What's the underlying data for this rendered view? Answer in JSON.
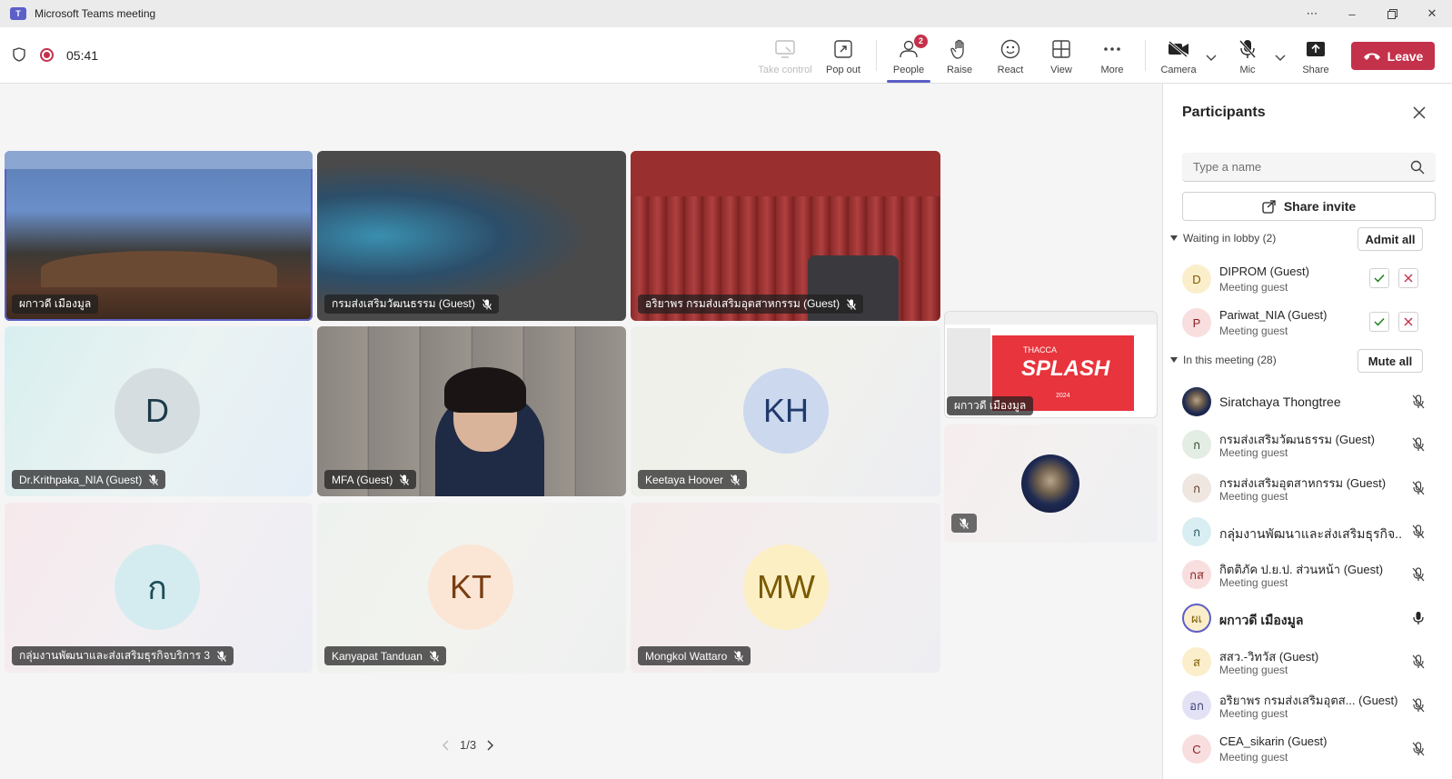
{
  "window": {
    "title": "Microsoft Teams meeting",
    "logo": "T",
    "controls": [
      "more",
      "minimize",
      "maximize",
      "close"
    ]
  },
  "toolbar": {
    "timer": "05:41",
    "take_control": "Take control",
    "pop_out": "Pop out",
    "people": "People",
    "people_badge": "2",
    "raise": "Raise",
    "react": "React",
    "view": "View",
    "more": "More",
    "camera": "Camera",
    "mic": "Mic",
    "share": "Share",
    "leave": "Leave",
    "colors": {
      "accent": "#5b5fc7",
      "leave": "#c4314b"
    }
  },
  "stage": {
    "tiles": [
      {
        "name": "ผกาวดี เมืองมูล",
        "kind": "video"
      },
      {
        "name": "กรมส่งเสริมวัฒนธรรม (Guest)",
        "kind": "video"
      },
      {
        "name": "อริยาพร กรมส่งเสริมอุตสาหกรรม (Guest)",
        "kind": "video"
      },
      {
        "name": "Dr.Krithpaka_NIA (Guest)",
        "initials": "D",
        "kind": "avatar"
      },
      {
        "name": "MFA (Guest)",
        "kind": "video"
      },
      {
        "name": "Keetaya Hoover",
        "initials": "KH",
        "kind": "avatar"
      },
      {
        "name": "กลุ่มงานพัฒนาและส่งเสริมธุรกิจบริการ 3",
        "initials": "ก",
        "kind": "avatar"
      },
      {
        "name": "Kanyapat Tanduan",
        "initials": "KT",
        "kind": "avatar"
      },
      {
        "name": "Mongkol Wattaro",
        "initials": "MW",
        "kind": "avatar"
      }
    ],
    "side_share": {
      "name": "ผกาวดี เมืองมูล",
      "slide_title": "THACCA",
      "slide_word": "SPLASH",
      "slide_year": "2024"
    },
    "pager": "1/3"
  },
  "panel": {
    "title": "Participants",
    "search_placeholder": "Type a name",
    "share_invite": "Share invite",
    "lobby_header": "Waiting in lobby (2)",
    "admit_all": "Admit all",
    "lobby": [
      {
        "initials": "D",
        "name": "DIPROM (Guest)",
        "sub": "Meeting guest"
      },
      {
        "initials": "P",
        "name": "Pariwat_NIA (Guest)",
        "sub": "Meeting guest"
      }
    ],
    "meeting_header": "In this meeting (28)",
    "mute_all": "Mute all",
    "members": [
      {
        "initials": "",
        "name": "Siratchaya Thongtree",
        "sub": ""
      },
      {
        "initials": "ก",
        "name": "กรมส่งเสริมวัฒนธรรม (Guest)",
        "sub": "Meeting guest"
      },
      {
        "initials": "ก",
        "name": "กรมส่งเสริมอุตสาหกรรม (Guest)",
        "sub": "Meeting guest"
      },
      {
        "initials": "ก",
        "name": "กลุ่มงานพัฒนาและส่งเสริมธุรกิจ...",
        "sub": ""
      },
      {
        "initials": "กส",
        "name": "กิตติภัค ป.ย.ป. ส่วนหน้า (Guest)",
        "sub": "Meeting guest"
      },
      {
        "initials": "ผเ",
        "name": "ผกาวดี เมืองมูล",
        "sub": ""
      },
      {
        "initials": "ส",
        "name": "สสว.-วิทวัส (Guest)",
        "sub": "Meeting guest"
      },
      {
        "initials": "อก",
        "name": "อริยาพร กรมส่งเสริมอุตส... (Guest)",
        "sub": "Meeting guest"
      },
      {
        "initials": "C",
        "name": "CEA_sikarin (Guest)",
        "sub": "Meeting guest"
      }
    ]
  }
}
